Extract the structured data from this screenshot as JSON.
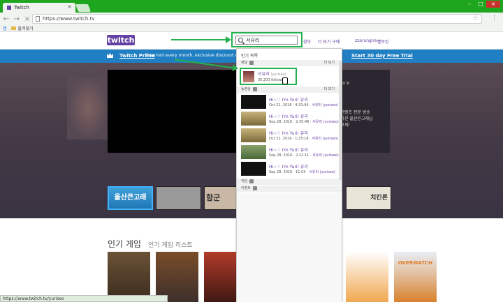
{
  "browser": {
    "tab_title": "Twitch",
    "url": "https://www.twitch.tv",
    "bookmarks": {
      "apps_label": "앱",
      "folder_label": "즐겨찾기"
    }
  },
  "header": {
    "logo": "twitch",
    "search_value": "서유리",
    "links": [
      "찾아",
      "더 보기 구매"
    ],
    "user": "zzarungna ▾",
    "notifications": "발로킹"
  },
  "prime": {
    "title": "Twitch Prime",
    "text": "Free loot every month, exclusive discount on new-relea...",
    "cta": "Start 30 day Free Trial"
  },
  "hero": {
    "side_lines": [
      "Auto V",
      "응 컨텐츠 전문 방송",
      "를 가진 울산큰고래님",
      "니 보세!"
    ],
    "thumbs": [
      "울산큰고래",
      "",
      "함군",
      "치킨론"
    ]
  },
  "dropdown": {
    "header": "인기 목록",
    "section_channels": "채널",
    "section_videos": "동영상",
    "section_games": "게임",
    "section_events": "이벤트",
    "more_label": "더 보기",
    "channel": {
      "name": "서유리",
      "id": "(yuriseo)",
      "followers": "35,203 followers"
    },
    "videos": [
      {
        "title": "Hi~♡ I'm Yuri! 유리",
        "date": "Oct 21, 2016",
        "duration": "4:31:04",
        "channel": "서유리 (yuriseo)"
      },
      {
        "title": "Hi~♡ I'm Yuri! 유리",
        "date": "Sep 28, 2016",
        "duration": "2:35:48",
        "channel": "서유리 (yuriseo)"
      },
      {
        "title": "Hi~♡ I'm Yuri! 유리",
        "date": "Oct 21, 2016",
        "duration": "1:25:18",
        "channel": "서유리 (yuriseo)"
      },
      {
        "title": "Hi~♡ I'm Yuri! 유리",
        "date": "Sep 28, 2016",
        "duration": "2:22:11",
        "channel": "서유리 (yuriseo)"
      },
      {
        "title": "Hi~♡ I'm Yuri! 유리",
        "date": "Sep 28, 2016",
        "duration": "11:03",
        "channel": "서유리 (yuriseo)"
      }
    ]
  },
  "games_section": {
    "title": "인기 게임",
    "subtitle": "인기 게임 리스트",
    "overwatch_label": "OVERWATCH"
  },
  "status_url": "https://www.twitch.tv/yuriseo",
  "colors": {
    "accent": "#6441a4",
    "annotation": "#22b14c",
    "prime": "#1f7fc2",
    "chrome": "#1fa61f"
  }
}
